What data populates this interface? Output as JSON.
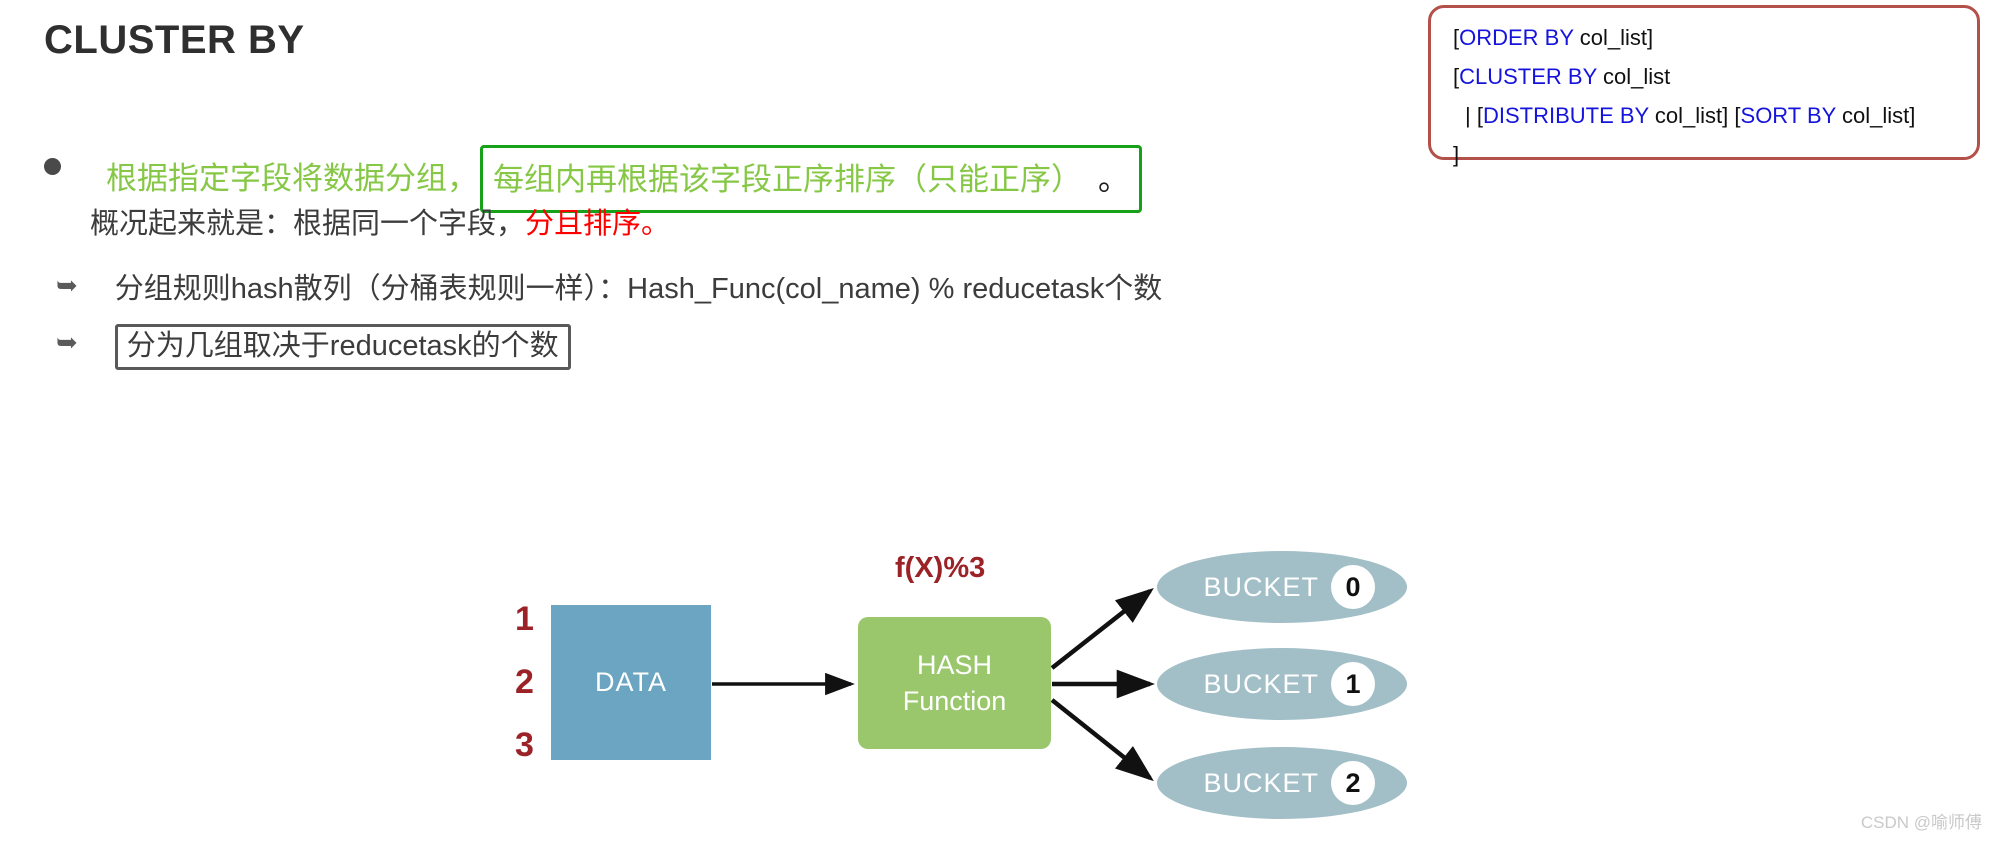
{
  "page": {
    "title": "CLUSTER BY",
    "watermark": "CSDN @喻师傅"
  },
  "bullets": [
    {
      "marker": "dot",
      "lead_text": "根据指定字段将数据分组，",
      "boxed_text": "每组内再根据该字段正序排序（只能正序）",
      "boxed_tail": "。",
      "sub_text_prefix": "概况起来就是：根据同一个字段，",
      "sub_text_highlight": "分且排序",
      "sub_text_suffix": "。"
    },
    {
      "marker": "arrow",
      "text": "分组规则hash散列（分桶表规则一样）：Hash_Func(col_name) % reducetask个数"
    },
    {
      "marker": "arrow",
      "boxed_text": "分为几组取决于reducetask的个数"
    }
  ],
  "syntax_box": {
    "lines": [
      {
        "prefix": "[",
        "keyword": "ORDER BY",
        "suffix": " col_list]"
      },
      {
        "prefix": "[",
        "keyword": "CLUSTER BY",
        "suffix": " col_list"
      },
      {
        "prefix": " | [",
        "keyword": "DISTRIBUTE BY",
        "mid": " col_list] [",
        "keyword2": "SORT BY",
        "suffix": " col_list]"
      },
      {
        "prefix": "]",
        "keyword": "",
        "suffix": ""
      }
    ],
    "line1_prefix": "[",
    "line1_keyword": "ORDER BY",
    "line1_suffix": " col_list]",
    "line2_prefix": "[",
    "line2_keyword": "CLUSTER BY",
    "line2_suffix": " col_list",
    "line3_prefix": " | [",
    "line3_keyword": "DISTRIBUTE BY",
    "line3_mid": " col_list] [",
    "line3_keyword2": "SORT BY",
    "line3_suffix": " col_list]",
    "line4": "]",
    "border_color": "#b4504a",
    "keyword_color": "#1414dc"
  },
  "diagram": {
    "input_numbers": [
      "1",
      "2",
      "3"
    ],
    "data_box_label": "DATA",
    "data_box_color": "#6ba5c1",
    "hash_box_line1": "HASH",
    "hash_box_line2": "Function",
    "hash_box_color": "#9ac76c",
    "formula_label": "f(X)%3",
    "formula_color": "#9b2226",
    "buckets": [
      {
        "label": "BUCKET",
        "number": "0"
      },
      {
        "label": "BUCKET",
        "number": "1"
      },
      {
        "label": "BUCKET",
        "number": "2"
      }
    ],
    "bucket_color": "#a2bfc7"
  }
}
